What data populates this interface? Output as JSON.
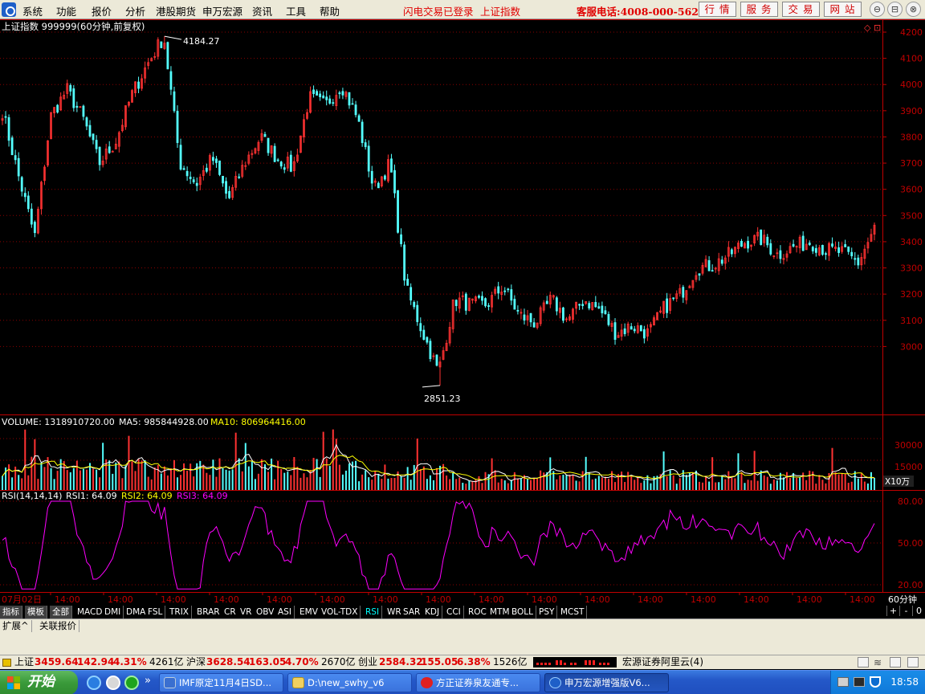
{
  "menu": {
    "items": [
      "系统",
      "功能",
      "报价",
      "分析",
      "港股期货",
      "申万宏源",
      "资讯",
      "工具",
      "帮助"
    ],
    "login_status": "闪电交易已登录",
    "current_index": "上证指数",
    "hotline": "客服电话:4008-000-562",
    "buttons": [
      "行情",
      "服务",
      "交易",
      "网站"
    ],
    "window_controls": [
      "⊖",
      "⊟",
      "⊠",
      "⊗"
    ]
  },
  "chart": {
    "header": "上证指数 999999(60分钟,前复权)",
    "high_label": "4184.27",
    "low_label": "2851.23",
    "price_ticks": [
      "4200",
      "4100",
      "4000",
      "3900",
      "3800",
      "3700",
      "3600",
      "3500",
      "3400",
      "3300",
      "3200",
      "3100",
      "3000"
    ],
    "volume_label": "VOLUME: 1318910720.00",
    "ma5_label": "MA5: 985844928.00",
    "ma10_label": "MA10: 806964416.00",
    "volume_ticks": [
      "30000",
      "15000"
    ],
    "volume_unit": "X10万",
    "rsi_label": "RSI(14,14,14)",
    "rsi1_label": "RSI1: 64.09",
    "rsi2_label": "RSI2: 64.09",
    "rsi3_label": "RSI3: 64.09",
    "rsi_ticks": [
      "80.00",
      "50.00",
      "20.00"
    ],
    "date_start": "07月02日",
    "time_label": "14:00",
    "period": "60分钟",
    "colors": {
      "up": "#ff3232",
      "down": "#54ffff",
      "ma5": "#ffffff",
      "ma10": "#ffff00",
      "rsi": "#ff00ff",
      "axis": "#c00000"
    }
  },
  "chart_data": {
    "type": "candlestick",
    "title": "上证指数 999999(60分钟,前复权)",
    "y_range": [
      2850,
      4200
    ],
    "high": 4184.27,
    "low": 2851.23,
    "approx_close_path": [
      3900,
      3650,
      3420,
      3880,
      3980,
      3870,
      3700,
      3780,
      3960,
      4080,
      4184,
      3700,
      3620,
      3720,
      3560,
      3700,
      3800,
      3720,
      3680,
      3950,
      3920,
      4000,
      3870,
      3600,
      3700,
      3220,
      3060,
      2900,
      3180,
      3160,
      3160,
      3230,
      3120,
      3090,
      3180,
      3100,
      3180,
      3140,
      3050,
      3080,
      3050,
      3150,
      3200,
      3300,
      3310,
      3350,
      3400,
      3410,
      3350,
      3380,
      3400,
      3370,
      3360,
      3320,
      3450
    ],
    "volume": {
      "last": 1318910720.0,
      "ma5": 985844928.0,
      "ma10": 806964416.0
    },
    "rsi": {
      "rsi1": 64.09,
      "rsi2": 64.09,
      "rsi3": 64.09,
      "range": [
        20,
        80
      ]
    }
  },
  "indicators": {
    "tabs": [
      "指标",
      "模板",
      "全部",
      "MACD",
      "DMI",
      "DMA",
      "FSL",
      "TRIX",
      "BRAR",
      "CR",
      "VR",
      "OBV",
      "ASI",
      "EMV",
      "VOL-TDX",
      "RSI",
      "WR",
      "SAR",
      "KDJ",
      "CCI",
      "ROC",
      "MTM",
      "BOLL",
      "PSY",
      "MCST"
    ],
    "controls": [
      "+",
      "-",
      "0"
    ]
  },
  "bottom_tabs": [
    "扩展^",
    "关联报价"
  ],
  "status": {
    "sh_label": "上证",
    "sh_value": "3459.64",
    "sh_change": "142.94",
    "sh_pct": "4.31%",
    "sh_amount": "4261亿",
    "hs_label": "沪深",
    "hs_value": "3628.54",
    "hs_change": "163.05",
    "hs_pct": "4.70%",
    "hs_amount": "2670亿",
    "cy_label": "创业",
    "cy_value": "2584.32",
    "cy_change": "155.05",
    "cy_pct": "6.38%",
    "cy_amount": "1526亿",
    "broker": "宏源证券阿里云(4)"
  },
  "taskbar": {
    "start": "开始",
    "chevron": "»",
    "tasks": [
      "IMF原定11月4日SD...",
      "D:\\new_swhy_v6",
      "方正证券泉友通专...",
      "申万宏源增强版V6..."
    ],
    "clock": "18:58"
  }
}
